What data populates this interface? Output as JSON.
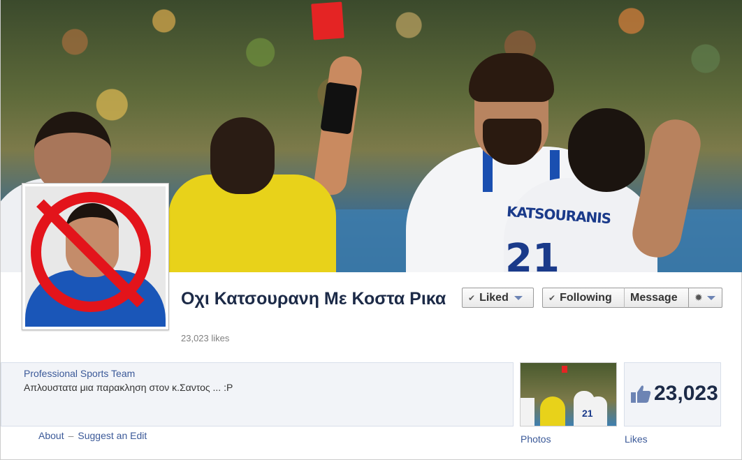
{
  "page": {
    "name": "Οχι Κατσουρανη Με Κοστα Ρικα",
    "likes_count": "23,023 likes"
  },
  "cover": {
    "jersey_name": "KATSOURANIS",
    "jersey_number": "21"
  },
  "actions": {
    "liked_label": "Liked",
    "following_label": "Following",
    "message_label": "Message",
    "check_icon": "checkmark-icon",
    "gear_icon": "gear-icon"
  },
  "about": {
    "category": "Professional Sports Team",
    "description": "Απλουστατα μια παρακληση στον κ.Σαντος ... :P",
    "about_link": "About",
    "separator": "–",
    "suggest_edit_link": "Suggest an Edit"
  },
  "apps": {
    "photos_label": "Photos",
    "photos_thumb_number": "21",
    "likes_value": "23,023",
    "likes_label": "Likes",
    "thumb_icon": "thumbs-up-icon"
  },
  "colors": {
    "link": "#3b5998",
    "ban_red": "#e3141b",
    "title": "#1c2a47"
  }
}
